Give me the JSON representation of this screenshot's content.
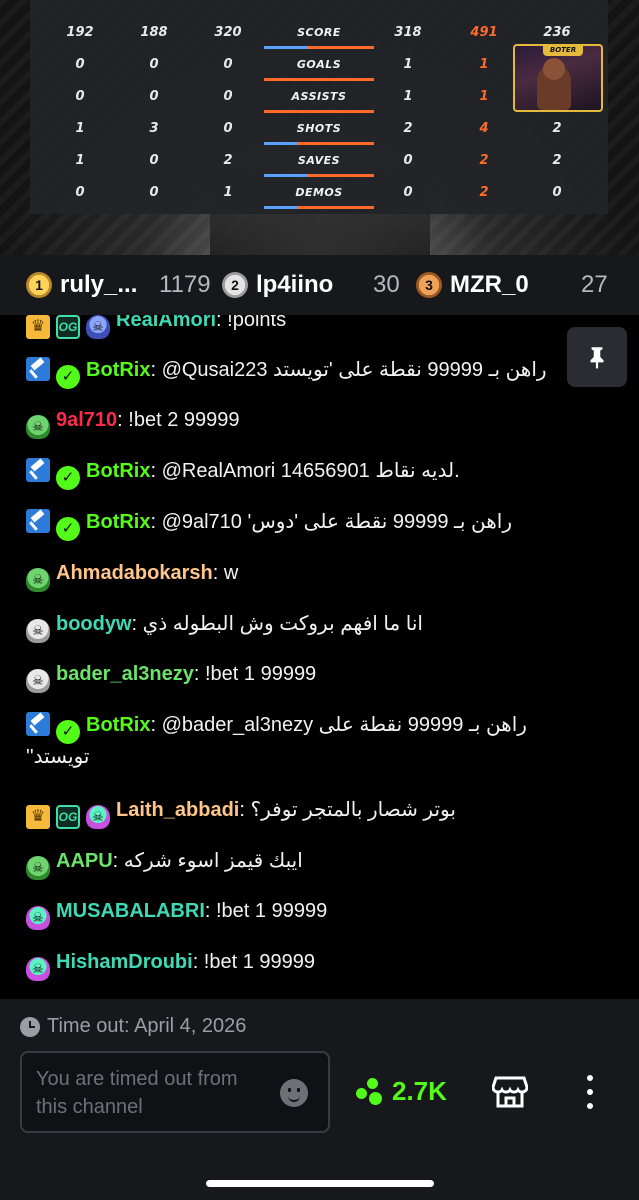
{
  "scoreboard": {
    "rows": [
      {
        "label": "SCORE",
        "values": [
          "192",
          "188",
          "320",
          "318",
          "491",
          "236"
        ],
        "bar": 0.4
      },
      {
        "label": "GOALS",
        "values": [
          "0",
          "0",
          "0",
          "1",
          "1",
          ""
        ],
        "bar": 0.0
      },
      {
        "label": "ASSISTS",
        "values": [
          "0",
          "0",
          "0",
          "1",
          "1",
          ""
        ],
        "bar": 0.0
      },
      {
        "label": "SHOTS",
        "values": [
          "1",
          "3",
          "0",
          "2",
          "4",
          "2"
        ],
        "bar": 0.3
      },
      {
        "label": "SAVES",
        "values": [
          "1",
          "0",
          "2",
          "0",
          "2",
          "2"
        ],
        "bar": 0.4
      },
      {
        "label": "DEMOS",
        "values": [
          "0",
          "0",
          "1",
          "0",
          "2",
          "0"
        ],
        "bar": 0.3
      }
    ],
    "webcam_tag": "BOTER"
  },
  "leaderboard": [
    {
      "rank": "1",
      "name": "ruly_...",
      "points": "1179"
    },
    {
      "rank": "2",
      "name": "lp4iino",
      "points": "30"
    },
    {
      "rank": "3",
      "name": "MZR_0",
      "points": "27"
    }
  ],
  "chat": {
    "messages": [
      {
        "user": "RealAmori",
        "color": "#3fd9b5",
        "text": ": !points"
      },
      {
        "user": "BotRix",
        "color": "#53fc18",
        "text": ": @Qusai223 راهن بـ 99999 نقطة على 'تويستد"
      },
      {
        "user": "9al710",
        "color": "#ff2a4a",
        "text": ": !bet 2 99999"
      },
      {
        "user": "BotRix",
        "color": "#53fc18",
        "text": ": @RealAmori لديه نقاط 14656901."
      },
      {
        "user": "BotRix",
        "color": "#53fc18",
        "text": ": @9al710 'راهن بـ 99999 نقطة على 'دوس"
      },
      {
        "user": "Ahmadabokarsh",
        "color": "#ffc58a",
        "text": ": w"
      },
      {
        "user": "boodyw",
        "color": "#3fd9b5",
        "text": ": انا ما افهم بروكت وش البطوله ذي"
      },
      {
        "user": "bader_al3nezy",
        "color": "#6be36b",
        "text": ": !bet 1 99999"
      },
      {
        "user": "BotRix",
        "color": "#53fc18",
        "text": ": @bader_al3nezy راهن بـ 99999 نقطة على",
        "text2": "''تويستد"
      },
      {
        "user": "Laith_abbadi",
        "color": "#ffc58a",
        "text": ": بوتر شصار بالمتجر توفر؟"
      },
      {
        "user": "AAPU",
        "color": "#6be36b",
        "text": ": ايبك قيمز اسوء شركه"
      },
      {
        "user": "MUSABALABRI",
        "color": "#3fd9b5",
        "text": ": !bet 1 99999"
      },
      {
        "user": "HishamDroubi",
        "color": "#3fd9b5",
        "text": ": !bet 1 99999"
      }
    ]
  },
  "bottom": {
    "timeout_text": "Time out: April 4, 2026",
    "input_placeholder": "You are timed out from this channel",
    "points": "2.7K"
  },
  "colors": {
    "brand": "#53fc18",
    "accent_orange": "#ff6a2b",
    "background": "#000000"
  }
}
